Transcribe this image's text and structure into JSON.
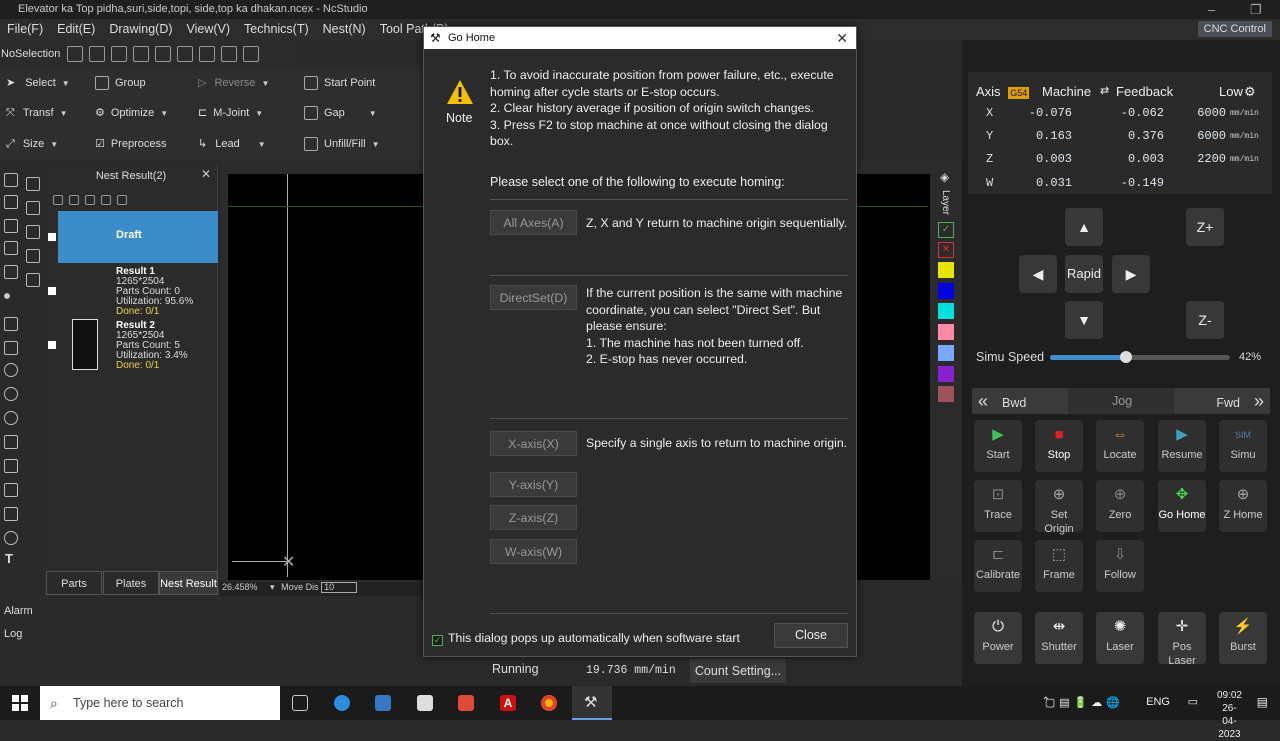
{
  "window": {
    "title": "Elevator ka Top pidha,suri,side,topi, side,top ka dhakan.ncex - NcStudio"
  },
  "menu": [
    "File(F)",
    "Edit(E)",
    "Drawing(D)",
    "View(V)",
    "Technics(T)",
    "Nest(N)",
    "Tool Path(P)"
  ],
  "cnc_control_label": "CNC Control",
  "toolbar": {
    "selection": "NoSelection"
  },
  "ribbon": {
    "select": "Select",
    "group": "Group",
    "reverse": "Reverse",
    "start_point": "Start Point",
    "transf": "Transf",
    "optimize": "Optimize",
    "m_joint": "M-Joint",
    "gap": "Gap",
    "size": "Size",
    "preprocess": "Preprocess",
    "lead": "Lead",
    "unfill": "Unfill/Fill"
  },
  "nest_panel": {
    "title": "Nest Result(2)",
    "draft": "Draft",
    "results": [
      {
        "name": "Result 1",
        "size": "1265*2504",
        "parts": "Parts Count: 0",
        "util": "Utilization: 95.6%",
        "done": "Done: 0/1"
      },
      {
        "name": "Result 2",
        "size": "1265*2504",
        "parts": "Parts Count: 5",
        "util": "Utilization: 3.4%",
        "done": "Done: 0/1"
      }
    ],
    "tabs": [
      "Parts",
      "Plates",
      "Nest Result"
    ]
  },
  "canvas": {
    "zoom": "26.458%",
    "move_label": "Move Dis",
    "move_value": "10",
    "layer_label": "Layer"
  },
  "layers": {
    "colors": [
      "#e5e500",
      "#0000e0",
      "#00e0e0",
      "#ff8aa8",
      "#7aa7ff",
      "#8a1fd0",
      "#a0525a"
    ]
  },
  "bottom_left": {
    "alarm": "Alarm",
    "log": "Log"
  },
  "run_bar": {
    "state": "Running",
    "speed": "19.736 mm/min",
    "count_setting": "Count Setting..."
  },
  "cnc": {
    "axis_header": "Axis",
    "coord": "G54",
    "machine": "Machine",
    "feedback": "Feedback",
    "low": "Low",
    "axes": [
      {
        "name": "X",
        "machine": "-0.076",
        "feedback": "-0.062",
        "speed": "6000",
        "unit": "mm/min"
      },
      {
        "name": "Y",
        "machine": "0.163",
        "feedback": "0.376",
        "speed": "6000",
        "unit": "mm/min"
      },
      {
        "name": "Z",
        "machine": "0.003",
        "feedback": "0.003",
        "speed": "2200",
        "unit": "mm/min"
      },
      {
        "name": "W",
        "machine": "0.031",
        "feedback": "-0.149",
        "speed": "",
        "unit": ""
      }
    ],
    "jog": {
      "rapid": "Rapid",
      "z_plus": "Z+",
      "z_minus": "Z-"
    },
    "simu_speed": {
      "label": "Simu Speed",
      "percent": "42%",
      "value": 42
    },
    "bwd": "Bwd",
    "jog_label": "Jog",
    "fwd": "Fwd",
    "controls": [
      {
        "label": "Start",
        "glyph": "▶",
        "color": "#3fbf5a"
      },
      {
        "label": "Stop",
        "glyph": "■",
        "color": "#e02020"
      },
      {
        "label": "Locate",
        "glyph": "⇔",
        "color": "#e0902a"
      },
      {
        "label": "Resume",
        "glyph": "▶",
        "color": "#3aa3c0"
      },
      {
        "label": "Simu",
        "glyph": "SIM",
        "color": "#5a7aa8"
      },
      {
        "label": "Trace",
        "glyph": "⊡",
        "color": "#888"
      },
      {
        "label": "Set Origin",
        "glyph": "⊕",
        "color": "#aaa"
      },
      {
        "label": "Zero",
        "glyph": "⊕",
        "color": "#888"
      },
      {
        "label": "Go Home",
        "glyph": "✥",
        "color": "#4ad44a"
      },
      {
        "label": "Z Home",
        "glyph": "⊕",
        "color": "#aaa"
      },
      {
        "label": "Calibrate",
        "glyph": "⊏",
        "color": "#888"
      },
      {
        "label": "Frame",
        "glyph": "⬚",
        "color": "#aaa"
      },
      {
        "label": "Follow",
        "glyph": "⇩",
        "color": "#888"
      },
      {
        "label": "Power",
        "glyph": "⏻",
        "color": "#eee"
      },
      {
        "label": "Shutter",
        "glyph": "⇹",
        "color": "#eee"
      },
      {
        "label": "Laser",
        "glyph": "✺",
        "color": "#eee"
      },
      {
        "label": "Pos Laser",
        "glyph": "✛",
        "color": "#eee"
      },
      {
        "label": "Burst",
        "glyph": "⚡",
        "color": "#eee"
      }
    ]
  },
  "dialog": {
    "title": "Go Home",
    "note_label": "Note",
    "note_lines": [
      "1. To avoid inaccurate position from power failure, etc., execute homing after cycle starts or E-stop occurs.",
      "2. Clear history average if position of origin switch changes.",
      "3. Press F2 to stop machine at once without closing the dialog box."
    ],
    "prompt": "Please select one of the following to execute homing:",
    "all_axes": "All Axes(A)",
    "all_axes_desc": "Z, X and Y return to machine origin sequentially.",
    "directset": "DirectSet(D)",
    "directset_desc": "If the current position is the same with machine coordinate, you can select \"Direct Set\". But please ensure:",
    "directset_1": "1. The machine has not been turned off.",
    "directset_2": "2. E-stop has never occurred.",
    "x_axis": "X-axis(X)",
    "single_desc": "Specify a single axis to return to machine origin.",
    "y_axis": "Y-axis(Y)",
    "z_axis": "Z-axis(Z)",
    "w_axis": "W-axis(W)",
    "auto_popup": "This dialog pops up automatically when software start",
    "close": "Close"
  },
  "taskbar": {
    "search_placeholder": "Type here to search",
    "time": "09:02",
    "date": "26-04-2023",
    "lang": "ENG"
  }
}
